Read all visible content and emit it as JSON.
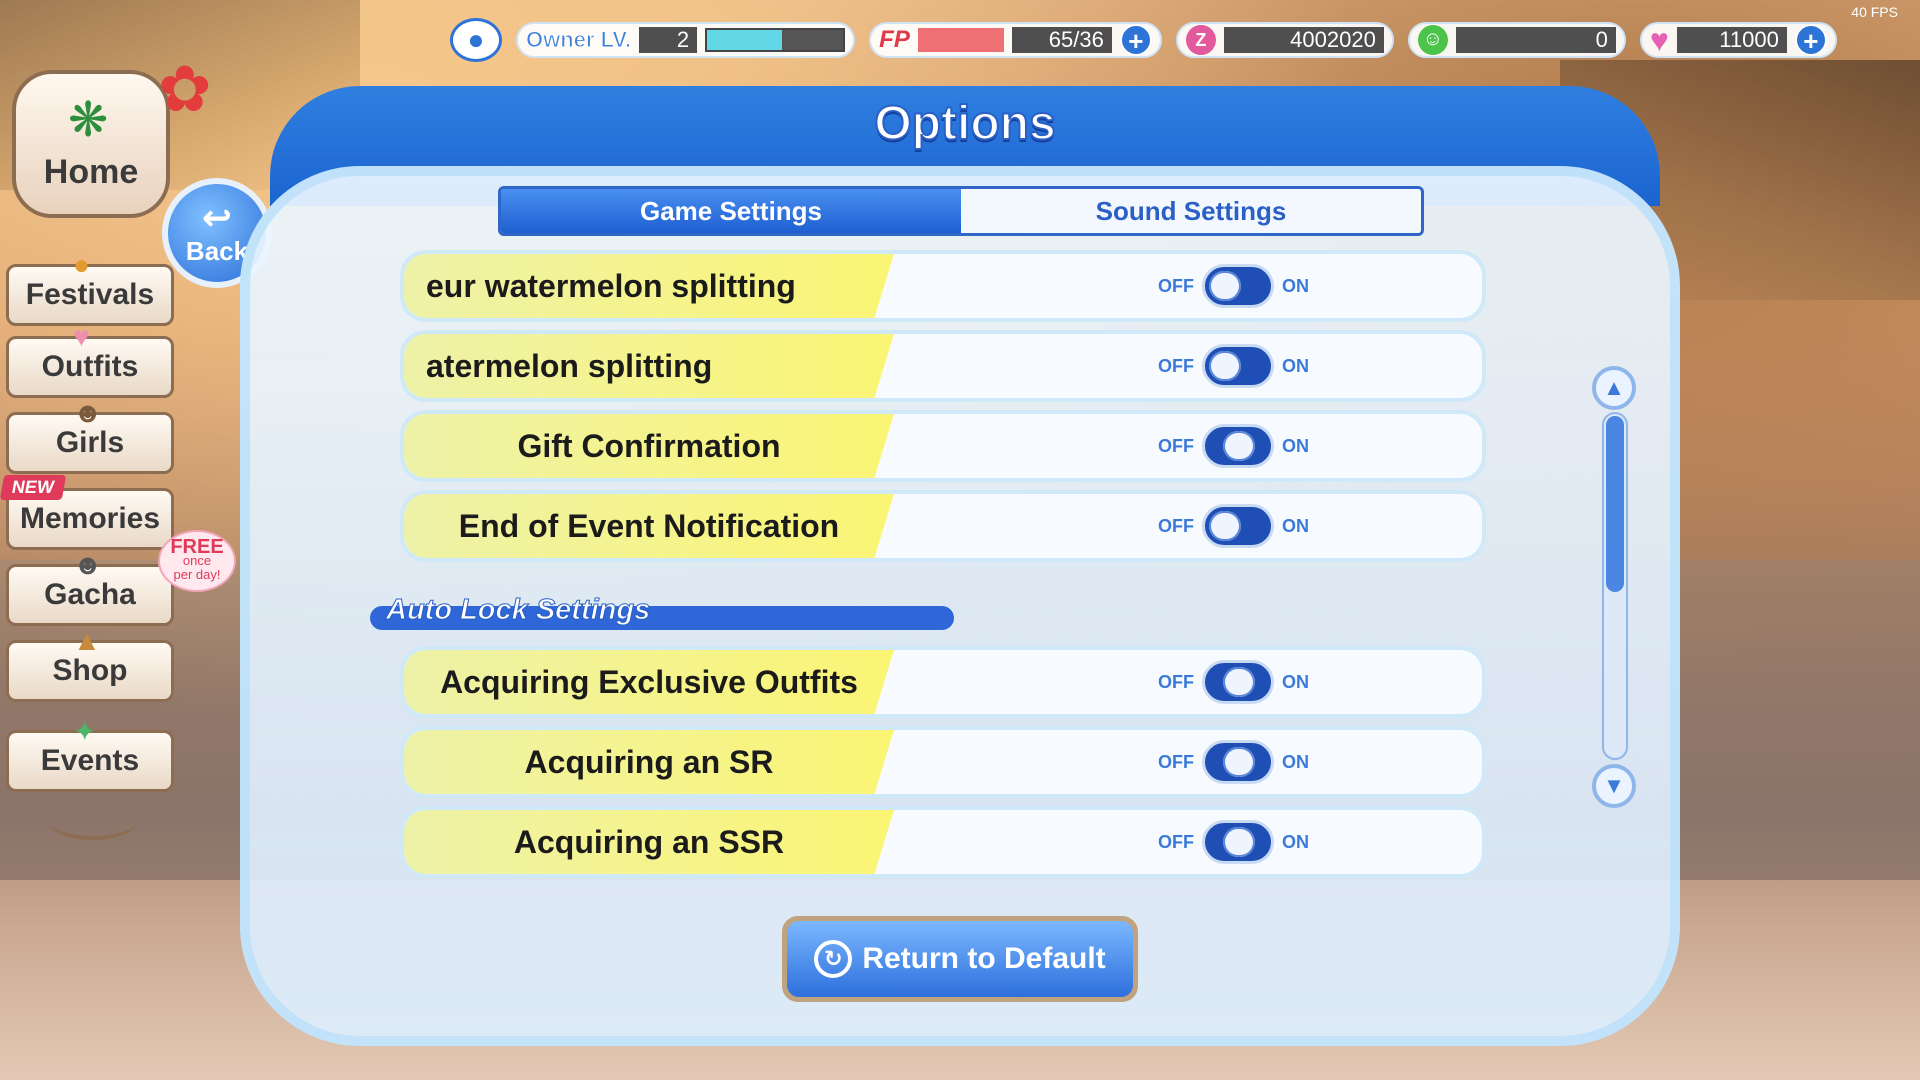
{
  "hud": {
    "fps": "40 FPS",
    "owner_label": "Owner LV.",
    "owner_level": "2",
    "owner_exp_fraction": 0.55,
    "fp_label": "FP",
    "fp_value": "65/36",
    "fp_fraction": 1.0,
    "currency_pink": "4002020",
    "currency_green": "0",
    "currency_heart": "11000"
  },
  "nav": {
    "home": "Home",
    "back": "Back",
    "items": [
      "Festivals",
      "Outfits",
      "Girls",
      "Memories",
      "Gacha",
      "Shop",
      "Events"
    ],
    "new_badge": "NEW",
    "free_badge_big": "FREE",
    "free_badge_line1": "once",
    "free_badge_line2": "per day!"
  },
  "dialog": {
    "title": "Options",
    "tabs": [
      {
        "label": "Game Settings",
        "active": true
      },
      {
        "label": "Sound Settings",
        "active": false
      }
    ],
    "off_label": "OFF",
    "on_label": "ON",
    "game_rows": [
      {
        "label": "eur watermelon splitting",
        "state": "off"
      },
      {
        "label": "atermelon splitting",
        "state": "off"
      },
      {
        "label": "Gift Confirmation",
        "state": "on"
      },
      {
        "label": "End of Event Notification",
        "state": "off"
      }
    ],
    "section_title": "Auto Lock Settings",
    "auto_lock_rows": [
      {
        "label": "Acquiring Exclusive Outfits",
        "state": "on"
      },
      {
        "label": "Acquiring an SR",
        "state": "on"
      },
      {
        "label": "Acquiring an SSR",
        "state": "on"
      }
    ],
    "return_default": "Return to Default",
    "scroll_position_fraction": 0.0
  },
  "colors": {
    "accent_blue": "#1e5fd1",
    "label_yellow": "#fbf574",
    "fp_red": "#e03a4a"
  }
}
